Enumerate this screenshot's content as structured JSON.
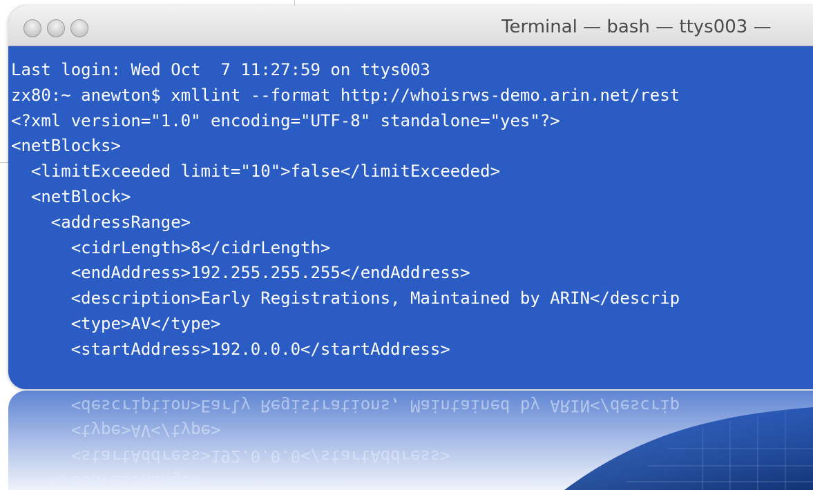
{
  "window": {
    "title": "Terminal — bash — ttys003 —"
  },
  "terminal": {
    "lines": [
      "Last login: Wed Oct  7 11:27:59 on ttys003",
      "zx80:~ anewton$ xmllint --format http://whoisrws-demo.arin.net/rest",
      "<?xml version=\"1.0\" encoding=\"UTF-8\" standalone=\"yes\"?>",
      "<netBlocks>",
      "  <limitExceeded limit=\"10\">false</limitExceeded>",
      "  <netBlock>",
      "    <addressRange>",
      "      <cidrLength>8</cidrLength>",
      "      <endAddress>192.255.255.255</endAddress>",
      "      <description>Early Registrations, Maintained by ARIN</descrip",
      "      <type>AV</type>",
      "      <startAddress>192.0.0.0</startAddress>"
    ],
    "reflection_lines": [
      "    </addressRange>",
      "      <startAddress>192.0.0.0</startAddress>",
      "      <type>AV</type>",
      "      <description>Early Registrations, Maintained by ARIN</descrip"
    ]
  },
  "colors": {
    "terminal_background": "#2a5cc4",
    "terminal_text": "#ffffff"
  }
}
